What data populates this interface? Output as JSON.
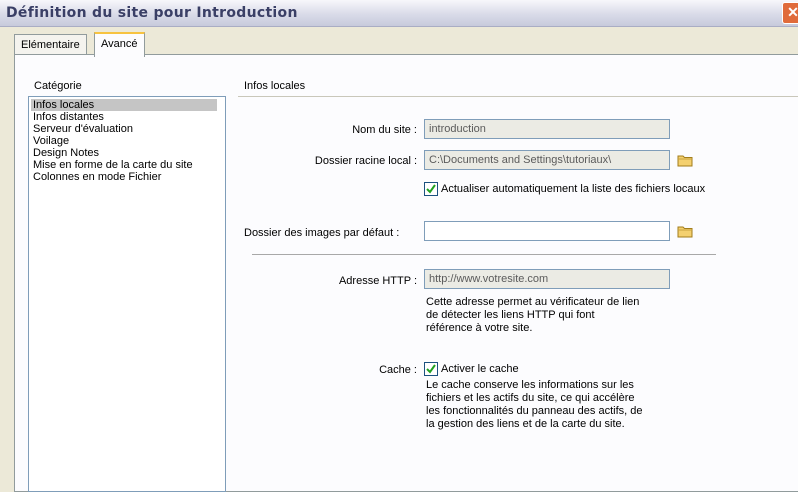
{
  "window": {
    "title": "Définition du site pour Introduction",
    "close": "✕"
  },
  "tabs": [
    {
      "label": "Elémentaire"
    },
    {
      "label": "Avancé"
    }
  ],
  "sidebar": {
    "category_label": "Catégorie",
    "items": [
      "Infos locales",
      "Infos distantes",
      "Serveur d'évaluation",
      "Voilage",
      "Design Notes",
      "Mise en forme de la carte du site",
      "Colonnes en mode Fichier"
    ],
    "selected_index": 0
  },
  "main": {
    "section_title": "Infos locales",
    "site_name": {
      "label": "Nom du site :",
      "value": "introduction"
    },
    "root_folder": {
      "label": "Dossier racine local :",
      "value": "C:\\Documents and Settings\\tutoriaux\\"
    },
    "auto_refresh": {
      "label": "Actualiser automatiquement la liste des fichiers locaux",
      "checked": true
    },
    "images_folder": {
      "label": "Dossier des images par défaut :",
      "value": ""
    },
    "http_address": {
      "label": "Adresse HTTP :",
      "value": "http://www.votresite.com"
    },
    "http_desc": [
      "Cette adresse permet au vérificateur de lien",
      "de détecter les liens HTTP qui font",
      "référence à votre site."
    ],
    "cache": {
      "label": "Cache :",
      "checkbox_label": "Activer le cache",
      "checked": true
    },
    "cache_desc": [
      "Le cache conserve les informations sur les",
      "fichiers et les actifs du site, ce qui accélère",
      "les fonctionnalités du panneau des actifs, de",
      "la gestion des liens et de la carte du site."
    ]
  },
  "colors": {
    "accent_tab": "#f7c340",
    "title_text": "#3a3f66",
    "close_button": "#e06b3b"
  }
}
